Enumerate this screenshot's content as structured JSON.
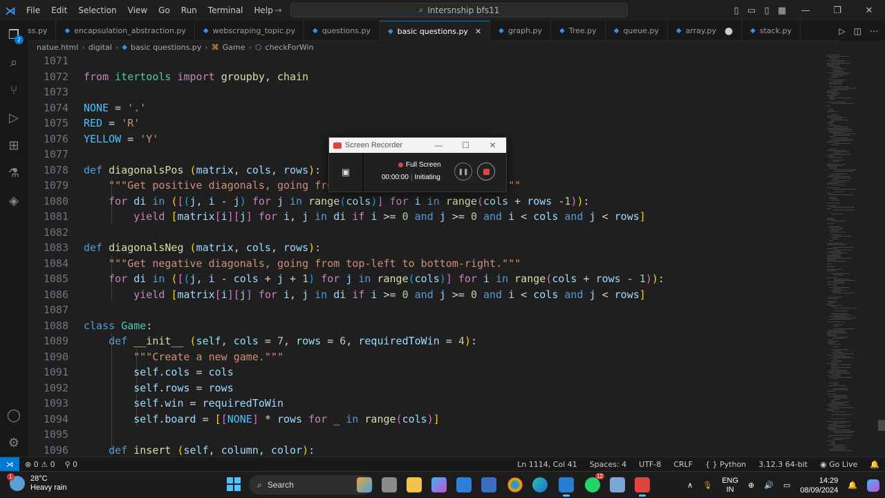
{
  "window": {
    "menu": [
      "File",
      "Edit",
      "Selection",
      "View",
      "Go",
      "Run",
      "Terminal",
      "Help"
    ],
    "search_text": "Intersnship bfs11"
  },
  "activity_bar": {
    "explorer_badge": "2"
  },
  "tabs": [
    {
      "label": "ss.py",
      "active": false
    },
    {
      "label": "encapsulation_abstraction.py",
      "active": false
    },
    {
      "label": "webscraping_topic.py",
      "active": false
    },
    {
      "label": "questions.py",
      "active": false
    },
    {
      "label": "basic questions.py",
      "active": true
    },
    {
      "label": "graph.py",
      "active": false
    },
    {
      "label": "Tree.py",
      "active": false
    },
    {
      "label": "queue.py",
      "active": false
    },
    {
      "label": "array.py",
      "active": false,
      "modified": true
    },
    {
      "label": "stack.py",
      "active": false
    }
  ],
  "breadcrumb": [
    "natue.html",
    "digital",
    "basic questions.py",
    "Game",
    "checkForWin"
  ],
  "editor": {
    "line_numbers": [
      "1071",
      "1072",
      "1073",
      "1074",
      "1075",
      "1076",
      "1077",
      "1078",
      "1079",
      "1080",
      "1081",
      "1082",
      "1083",
      "1084",
      "1085",
      "1086",
      "1087",
      "1088",
      "1089",
      "1090",
      "1091",
      "1092",
      "1093",
      "1094",
      "1095",
      "1096"
    ]
  },
  "recorder": {
    "title": "Screen Recorder",
    "mode": "Full Screen",
    "time": "00:00:00",
    "state": "Initiating"
  },
  "statusbar": {
    "errors": "0",
    "warnings": "0",
    "ports": "0",
    "position": "Ln 1114, Col 41",
    "spaces": "Spaces: 4",
    "encoding": "UTF-8",
    "eol": "CRLF",
    "language": "Python",
    "interpreter": "3.12.3 64-bit",
    "live": "Go Live"
  },
  "taskbar": {
    "weather_temp": "28°C",
    "weather_desc": "Heavy rain",
    "weather_badge": "1",
    "search_label": "Search",
    "whatsapp_badge": "12",
    "lang_top": "ENG",
    "lang_bottom": "IN",
    "time": "14:29",
    "date": "08/09/2024"
  },
  "colors": {
    "accent": "#0078d4",
    "keyword": "#569cd6",
    "function": "#dcdcaa",
    "string": "#ce9178",
    "record": "#e0443e"
  }
}
